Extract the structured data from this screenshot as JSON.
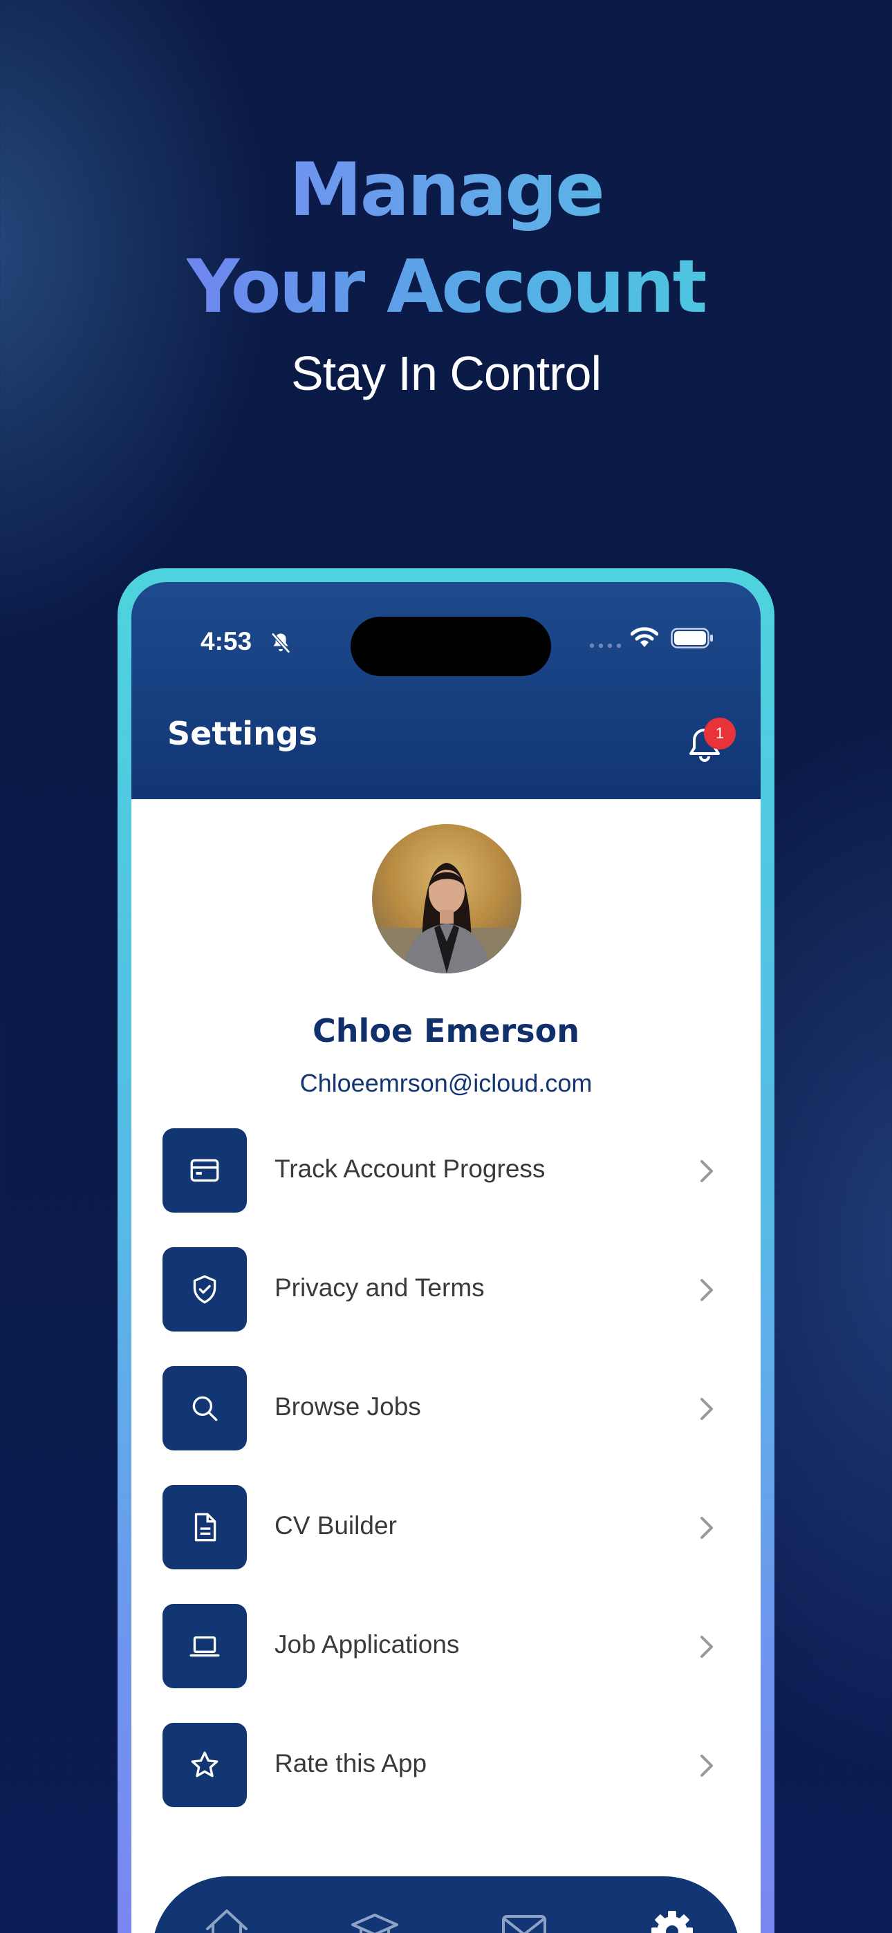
{
  "promo": {
    "title_line1": "Manage",
    "title_line2": "Your Account",
    "subtitle": "Stay In Control"
  },
  "status_bar": {
    "time": "4:53"
  },
  "header": {
    "title": "Settings",
    "notification_count": "1"
  },
  "profile": {
    "name": "Chloe Emerson",
    "email": "Chloeemrson@icloud.com"
  },
  "menu": {
    "items": [
      {
        "label": "Track Account Progress",
        "icon": "card-icon"
      },
      {
        "label": "Privacy and Terms",
        "icon": "shield-check-icon"
      },
      {
        "label": "Browse Jobs",
        "icon": "search-icon"
      },
      {
        "label": "CV Builder",
        "icon": "document-icon"
      },
      {
        "label": "Job Applications",
        "icon": "laptop-icon"
      },
      {
        "label": "Rate this App",
        "icon": "star-icon"
      }
    ]
  },
  "tabbar": {
    "tabs": [
      {
        "icon": "home-icon"
      },
      {
        "icon": "graduation-cap-icon"
      },
      {
        "icon": "mail-icon"
      },
      {
        "icon": "gear-icon",
        "active": true
      }
    ]
  },
  "colors": {
    "navy": "#123574",
    "frame_top": "#4ed3de",
    "frame_bottom": "#7e82f2",
    "badge": "#e8333a"
  }
}
